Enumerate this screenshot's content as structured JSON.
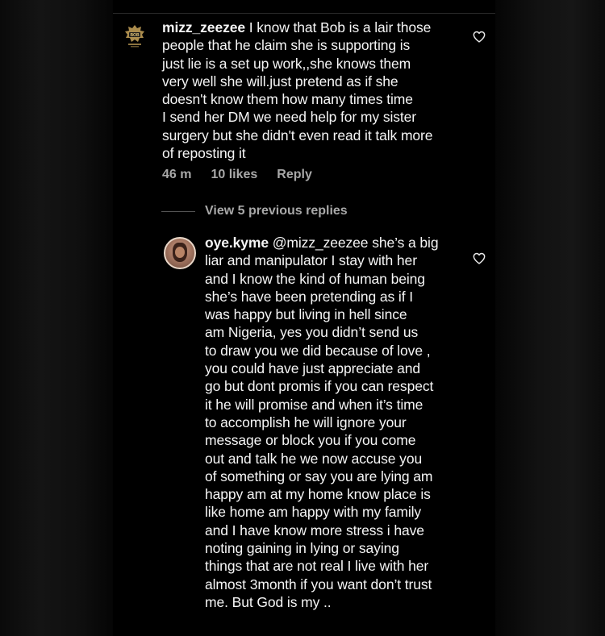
{
  "comments": [
    {
      "username": "mizz_zeezee",
      "avatar_text": "BOB",
      "lines": [
        " I know that Bob is a lair those",
        "people that he claim she is supporting is",
        "just lie is a set up work,,she knows them",
        "very well she will.just pretend as if she",
        "doesn't know them how many times time",
        "I send her DM we need help for my sister",
        "surgery but she didn't even read it talk more",
        "of reposting it"
      ],
      "time": "46 m",
      "likes": "10 likes",
      "reply_label": "Reply"
    },
    {
      "username": "oye.kyme",
      "lines": [
        " @mizz_zeezee she’s a big",
        "liar and manipulator I stay with her",
        "and I know the kind of human being",
        "she’s have been pretending as if I",
        "was happy but living in hell since",
        "am Nigeria, yes you didn’t send us",
        "to draw you we did because of love ,",
        "you could have just  appreciate and",
        "go but dont promis if you can respect",
        "it he will promise and when it’s time",
        "to accomplish he will ignore your",
        "message or block you if you come",
        "out and talk he we now accuse you",
        "of something or say you are lying am",
        "happy am at my home know place is",
        "like home am happy with my family",
        "and I have know more stress i have",
        "noting gaining in lying or saying",
        "things that are not real I live with her",
        "almost 3month if you want don’t trust",
        "me. But God is my .."
      ]
    }
  ],
  "view_replies": "View 5 previous replies",
  "icons": {
    "like": "heart-outline-icon"
  },
  "colors": {
    "background": "#000000",
    "text": "#f5f5f5",
    "secondary_text": "#a8a8a8"
  }
}
